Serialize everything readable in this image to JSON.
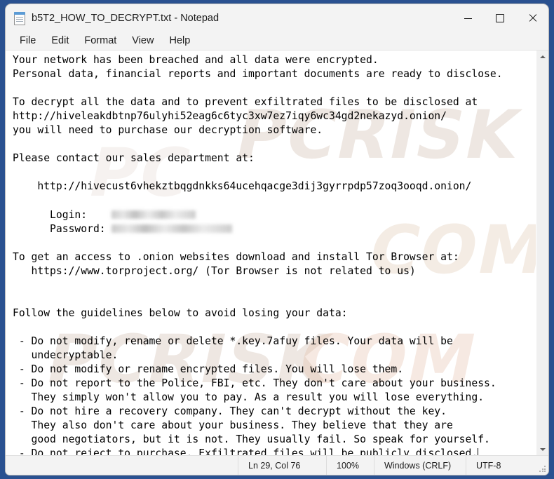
{
  "window": {
    "title": "b5T2_HOW_TO_DECRYPT.txt - Notepad",
    "icon": "text-document-icon",
    "controls": {
      "minimize_label": "–",
      "maximize_label": "□",
      "close_label": "✕"
    }
  },
  "menu": {
    "items": [
      {
        "label": "File"
      },
      {
        "label": "Edit"
      },
      {
        "label": "Format"
      },
      {
        "label": "View"
      },
      {
        "label": "Help"
      }
    ]
  },
  "document": {
    "filename": "b5T2_HOW_TO_DECRYPT.txt",
    "encrypted_extension": "*.key.7afuy",
    "leak_site_url": "http://hiveleakdbtnp76ulyhi52eag6c6tyc3xw7ez7iqy6wc34gd2nekazyd.onion/",
    "support_site_url": "http://hivecust6vhekztbqgdnkks64ucehqacge3dij3gyrrpdp57zoq3ooqd.onion/",
    "tor_project_url": "https://www.torproject.org/",
    "credentials": {
      "login_label": "Login:",
      "password_label": "Password:",
      "login_value": "[redacted]",
      "password_value": "[redacted]"
    },
    "body_part_1": "Your network has been breached and all data were encrypted.\nPersonal data, financial reports and important documents are ready to disclose.\n\nTo decrypt all the data and to prevent exfiltrated files to be disclosed at\nhttp://hiveleakdbtnp76ulyhi52eag6c6tyc3xw7ez7iqy6wc34gd2nekazyd.onion/\nyou will need to purchase our decryption software.\n\nPlease contact our sales department at:\n\n    http://hivecust6vhekztbqgdnkks64ucehqacge3dij3gyrrpdp57zoq3ooqd.onion/\n\n      Login:    ",
    "body_part_2": "\n      Password: ",
    "body_part_3": "\n\nTo get an access to .onion websites download and install Tor Browser at:\n   https://www.torproject.org/ (Tor Browser is not related to us)\n\n\nFollow the guidelines below to avoid losing your data:\n\n - Do not modify, rename or delete *.key.7afuy files. Your data will be\n   undecryptable.\n - Do not modify or rename encrypted files. You will lose them.\n - Do not report to the Police, FBI, etc. They don't care about your business.\n   They simply won't allow you to pay. As a result you will lose everything.\n - Do not hire a recovery company. They can't decrypt without the key.\n   They also don't care about your business. They believe that they are\n   good negotiators, but it is not. They usually fail. So speak for yourself.\n - Do not reject to purchase. Exfiltrated files will be publicly disclosed."
  },
  "watermark": {
    "line_1": "PCRISK",
    "line_2": "COM",
    "line_3": "PCRISK",
    "line_4": "COM",
    "line_5": "PC"
  },
  "scrollbar": {
    "up_arrow": "scroll-up-arrow",
    "down_arrow": "scroll-down-arrow"
  },
  "status_bar": {
    "position": "Ln 29, Col 76",
    "zoom": "100%",
    "line_ending": "Windows (CRLF)",
    "encoding": "UTF-8"
  },
  "colors": {
    "desktop": "#2a5190",
    "window_chrome": "#f3f3f3",
    "editor_background": "#ffffff",
    "text": "#000000",
    "accent_icon": "#5b9bd5"
  }
}
